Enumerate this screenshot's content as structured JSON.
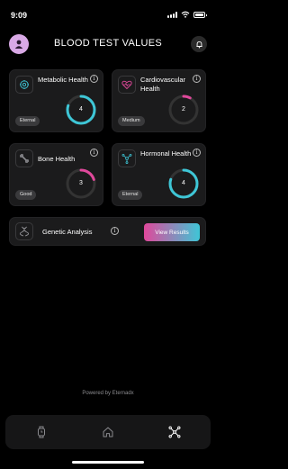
{
  "status_bar": {
    "time": "9:09"
  },
  "header": {
    "title": "BLOOD TEST VALUES"
  },
  "cards": [
    {
      "title": "Metabolic Health",
      "status": "Eternal",
      "score": "4",
      "score_fraction": 0.8,
      "accent": "#3ec6d6"
    },
    {
      "title": "Cardiovascular Health",
      "status": "Medium",
      "score": "2",
      "score_fraction": 0.0,
      "accent": "#e0489b"
    },
    {
      "title": "Bone Health",
      "status": "Good",
      "score": "3",
      "score_fraction": 0.2,
      "accent": "#e0489b"
    },
    {
      "title": "Hormonal Health",
      "status": "Eternal",
      "score": "4",
      "score_fraction": 0.8,
      "accent": "#3ec6d6"
    }
  ],
  "genetic": {
    "label": "Genetic Analysis",
    "button_label": "View Results"
  },
  "footer": {
    "powered_by": "Powered by Eternadx"
  },
  "bottom_nav": [
    "watch-icon",
    "home-icon",
    "network-icon"
  ],
  "colors": {
    "pink": "#e0489b",
    "cyan": "#3ec6d6",
    "card_bg": "#1b1b1c"
  }
}
